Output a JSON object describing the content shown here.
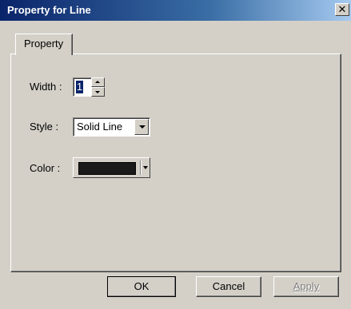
{
  "window": {
    "title": "Property for Line",
    "close_glyph": "✕"
  },
  "tabs": [
    {
      "label": "Property",
      "selected": true
    }
  ],
  "fields": {
    "width": {
      "label": "Width :",
      "value": "1"
    },
    "style": {
      "label": "Style :",
      "value": "Solid Line"
    },
    "color": {
      "label": "Color :",
      "value_color": "#1a1a1a"
    }
  },
  "buttons": {
    "ok": "OK",
    "cancel": "Cancel",
    "apply": "Apply"
  },
  "colors": {
    "titlebar": "#0a246a",
    "face": "#d4d0c8"
  }
}
